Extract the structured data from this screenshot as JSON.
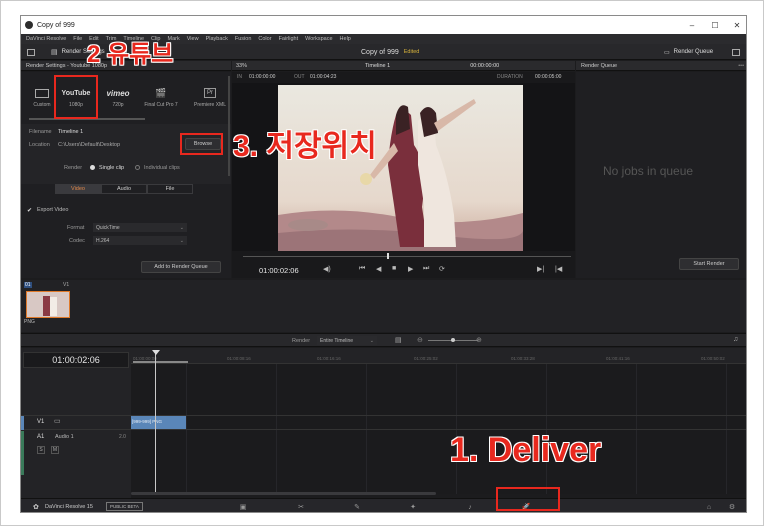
{
  "window": {
    "title": "Copy of 999",
    "minimize": "–",
    "maximize": "☐",
    "close": "✕"
  },
  "menu": [
    "DaVinci Resolve",
    "File",
    "Edit",
    "Trim",
    "Timeline",
    "Clip",
    "Mark",
    "View",
    "Playback",
    "Fusion",
    "Color",
    "Fairlight",
    "Workspace",
    "Help"
  ],
  "toolbar": {
    "render_settings": "Render Settings",
    "project_name": "Copy of 999",
    "edited": "Edited",
    "render_queue": "Render Queue",
    "zoom": "33%",
    "timeline_name": "Timeline 1",
    "timecode": "00:00:00:00"
  },
  "render_settings": {
    "header": "Render Settings - Youtube 1080p",
    "presets": [
      {
        "icon": "▭",
        "label": "Custom"
      },
      {
        "icon": "YouTube",
        "label": "1080p"
      },
      {
        "icon": "vimeo",
        "label": "720p"
      },
      {
        "icon": "🎬",
        "label": "Final Cut Pro 7"
      },
      {
        "icon": "Pr",
        "label": "Premiere XML"
      }
    ],
    "filename_label": "Filename",
    "filename_value": "Timeline 1",
    "location_label": "Location",
    "location_value": "C:\\Users\\Default\\Desktop",
    "browse": "Browse",
    "render_label": "Render",
    "single_clip": "Single clip",
    "individual_clips": "Individual clips",
    "tabs": [
      "Video",
      "Audio",
      "File"
    ],
    "export_video": "Export Video",
    "format_label": "Format",
    "format_value": "QuickTime",
    "codec_label": "Codec",
    "codec_value": "H.264",
    "add_to_queue": "Add to Render Queue"
  },
  "viewer": {
    "in_label": "IN",
    "in_tc": "01:00:00:00",
    "out_label": "OUT",
    "out_tc": "01:00:04:23",
    "duration_label": "DURATION",
    "duration_tc": "00:00:05:00",
    "current_tc": "01:00:02:06"
  },
  "render_queue": {
    "header": "Render Queue",
    "empty": "No jobs in queue",
    "start": "Start Render"
  },
  "clips": {
    "track_num": "01",
    "track_label": "V1",
    "clip_type": "PNG"
  },
  "timeline_bar": {
    "render_label": "Render",
    "range": "Entire Timeline"
  },
  "timeline": {
    "timecode": "01:00:02:06",
    "ruler": [
      "01:00:00:00",
      "01:00:08:16",
      "01:00:16:16",
      "01:00:25:02",
      "01:00:33:28",
      "01:00:41:16",
      "01:00:50:02"
    ],
    "v1": "V1",
    "a1": "A1",
    "audio_name": "Audio 1",
    "audio_ch": "2.0",
    "s": "S",
    "m": "M",
    "clip_label": "[999-999] PNG"
  },
  "footer": {
    "app": "DaVinci Resolve 15",
    "beta": "PUBLIC BETA"
  },
  "annotations": {
    "step1": "1. Deliver",
    "step2": "2 유튜브",
    "step3": "3. 저장위치"
  },
  "colors": {
    "accent_red": "#e8281e",
    "clip_blue": "#5a86b8",
    "edited_yellow": "#d9b43c"
  }
}
